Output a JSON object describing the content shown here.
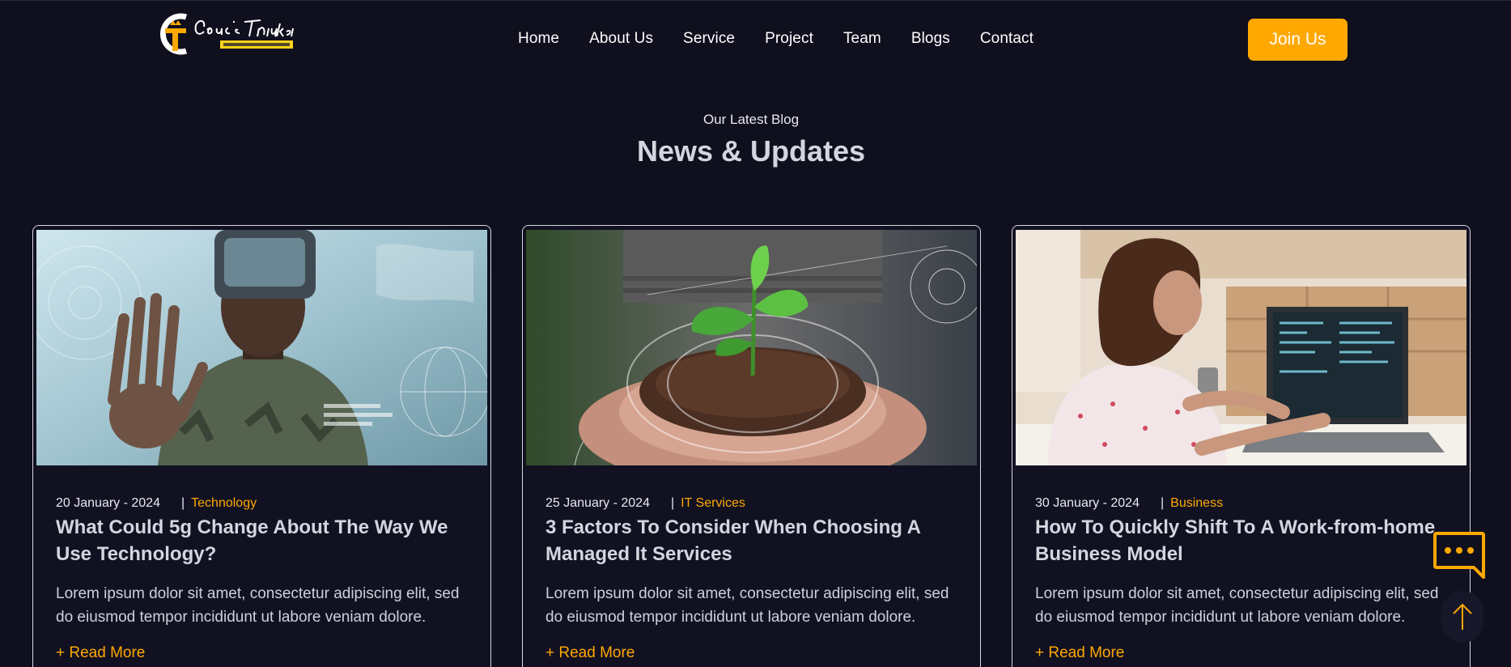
{
  "brand": {
    "logo_icon": "code-bracket-t-icon",
    "colors": {
      "accent": "#ffa800",
      "background": "#0f0f1e",
      "text": "#ffffff"
    }
  },
  "nav": {
    "items": [
      {
        "label": "Home"
      },
      {
        "label": "About Us"
      },
      {
        "label": "Service"
      },
      {
        "label": "Project"
      },
      {
        "label": "Team"
      },
      {
        "label": "Blogs"
      },
      {
        "label": "Contact"
      }
    ],
    "cta_label": "Join Us"
  },
  "section": {
    "eyebrow": "Our Latest Blog",
    "title": "News & Updates"
  },
  "posts": [
    {
      "image": "soldier-vr-headset-hologram-photo",
      "date": "20 January - 2024",
      "separator": "|",
      "category": "Technology",
      "title": "What Could 5g Change About The Way We Use Technology?",
      "excerpt": "Lorem ipsum dolor sit amet, consectetur adipiscing elit, sed do eiusmod tempor incididunt ut labore veniam dolore.",
      "link_label": "+ Read More"
    },
    {
      "image": "hands-holding-seedling-soil-photo",
      "date": "25 January - 2024",
      "separator": "|",
      "category": "IT Services",
      "title": "3 Factors To Consider When Choosing A Managed It Services",
      "excerpt": "Lorem ipsum dolor sit amet, consectetur adipiscing elit, sed do eiusmod tempor incididunt ut labore veniam dolore.",
      "link_label": "+ Read More"
    },
    {
      "image": "woman-coding-on-laptop-photo",
      "date": "30 January - 2024",
      "separator": "|",
      "category": "Business",
      "title": "How To Quickly Shift To A Work-from-home Business Model",
      "excerpt": "Lorem ipsum dolor sit amet, consectetur adipiscing elit, sed do eiusmod tempor incididunt ut labore veniam dolore.",
      "link_label": "+ Read More"
    }
  ],
  "widgets": {
    "chat_icon": "chat-bubble-icon",
    "scroll_icon": "arrow-up-icon"
  }
}
